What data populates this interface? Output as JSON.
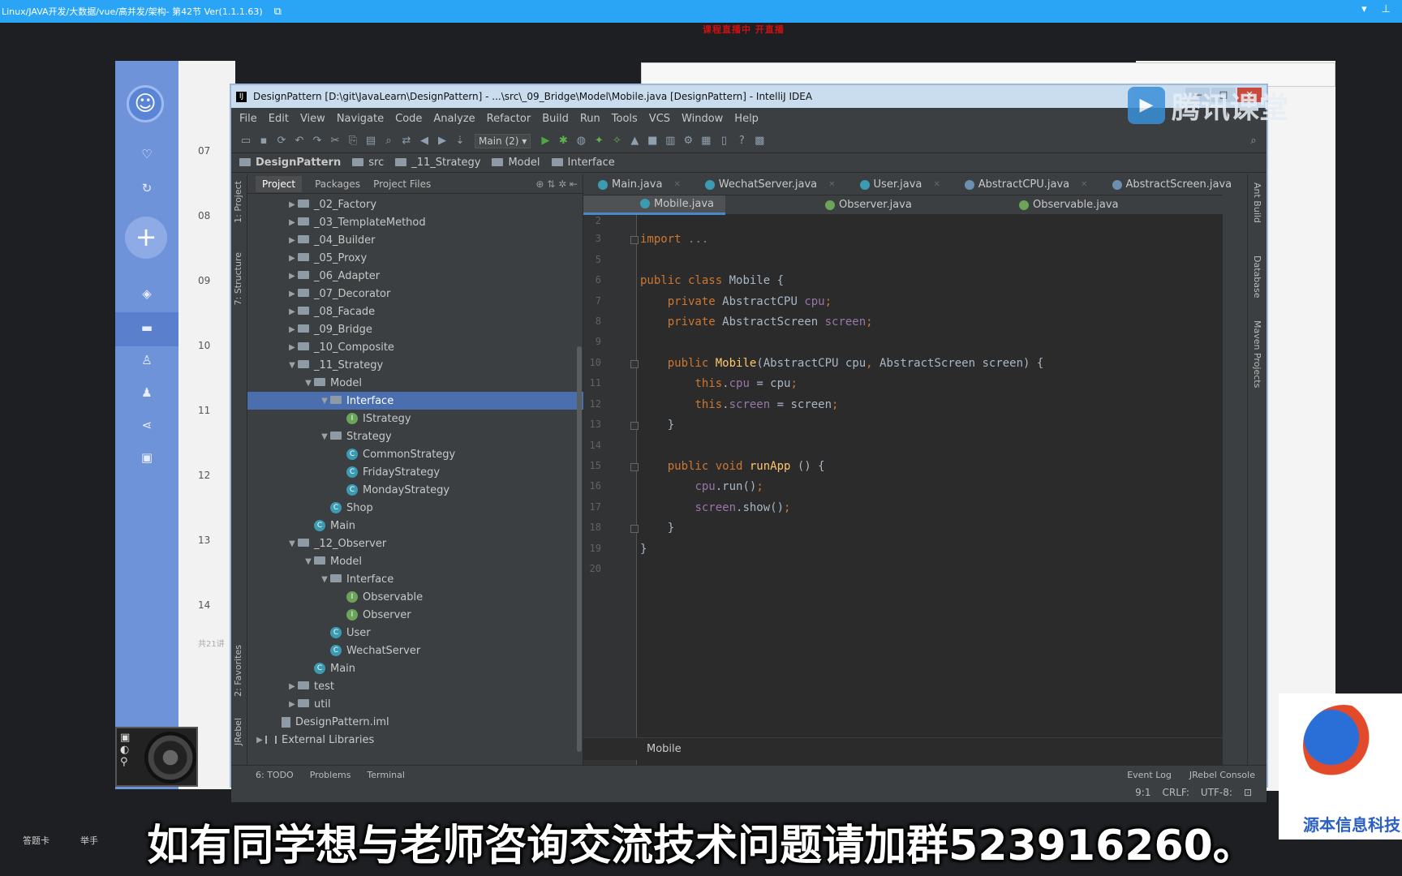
{
  "os": {
    "window_title": "Linux/JAVA开发/大数据/vue/高并发/架构- 第42节 Ver(1.1.1.63)",
    "red_notice": "课程直播中  开直播",
    "caption": "如有同学想与老师咨询交流技术问题请加群523916260。",
    "taskbar": [
      "答题卡",
      "举手"
    ]
  },
  "left_app": {
    "list_rows": [
      "07",
      "08",
      "09",
      "10",
      "11",
      "12",
      "13",
      "14"
    ],
    "footer": "共21讲"
  },
  "watermark": {
    "text": "腾讯课堂"
  },
  "brand": {
    "text": "源本信息科技"
  },
  "ide": {
    "title": "DesignPattern [D:\\git\\JavaLearn\\DesignPattern] - ...\\src\\_09_Bridge\\Model\\Mobile.java [DesignPattern] - IntelliJ IDEA",
    "menu": [
      "File",
      "Edit",
      "View",
      "Navigate",
      "Code",
      "Analyze",
      "Refactor",
      "Build",
      "Run",
      "Tools",
      "VCS",
      "Window",
      "Help"
    ],
    "run_config": "Main (2)",
    "breadcrumb": [
      "DesignPattern",
      "src",
      "_11_Strategy",
      "Model",
      "Interface"
    ],
    "project_tabs": [
      "Project",
      "Packages",
      "Project Files"
    ],
    "left_tools": [
      "1: Project",
      "7: Structure",
      "2: Favorites",
      "JRebel"
    ],
    "right_tools": [
      "Ant Build",
      "Database",
      "Maven Projects"
    ],
    "tree": [
      {
        "label": "_02_Factory",
        "indent": 2,
        "type": "folder",
        "arrow": "right"
      },
      {
        "label": "_03_TemplateMethod",
        "indent": 2,
        "type": "folder",
        "arrow": "right"
      },
      {
        "label": "_04_Builder",
        "indent": 2,
        "type": "folder",
        "arrow": "right"
      },
      {
        "label": "_05_Proxy",
        "indent": 2,
        "type": "folder",
        "arrow": "right"
      },
      {
        "label": "_06_Adapter",
        "indent": 2,
        "type": "folder",
        "arrow": "right"
      },
      {
        "label": "_07_Decorator",
        "indent": 2,
        "type": "folder",
        "arrow": "right"
      },
      {
        "label": "_08_Facade",
        "indent": 2,
        "type": "folder",
        "arrow": "right"
      },
      {
        "label": "_09_Bridge",
        "indent": 2,
        "type": "folder",
        "arrow": "right"
      },
      {
        "label": "_10_Composite",
        "indent": 2,
        "type": "folder",
        "arrow": "right"
      },
      {
        "label": "_11_Strategy",
        "indent": 2,
        "type": "folder",
        "arrow": "down"
      },
      {
        "label": "Model",
        "indent": 3,
        "type": "folder",
        "arrow": "down"
      },
      {
        "label": "Interface",
        "indent": 4,
        "type": "folder",
        "arrow": "down",
        "selected": true
      },
      {
        "label": "IStrategy",
        "indent": 5,
        "type": "interface",
        "arrow": ""
      },
      {
        "label": "Strategy",
        "indent": 4,
        "type": "folder",
        "arrow": "down"
      },
      {
        "label": "CommonStrategy",
        "indent": 5,
        "type": "class",
        "arrow": ""
      },
      {
        "label": "FridayStrategy",
        "indent": 5,
        "type": "class",
        "arrow": ""
      },
      {
        "label": "MondayStrategy",
        "indent": 5,
        "type": "class",
        "arrow": ""
      },
      {
        "label": "Shop",
        "indent": 4,
        "type": "class",
        "arrow": ""
      },
      {
        "label": "Main",
        "indent": 3,
        "type": "class",
        "arrow": ""
      },
      {
        "label": "_12_Observer",
        "indent": 2,
        "type": "folder",
        "arrow": "down"
      },
      {
        "label": "Model",
        "indent": 3,
        "type": "folder",
        "arrow": "down"
      },
      {
        "label": "Interface",
        "indent": 4,
        "type": "folder",
        "arrow": "down"
      },
      {
        "label": "Observable",
        "indent": 5,
        "type": "interface",
        "arrow": ""
      },
      {
        "label": "Observer",
        "indent": 5,
        "type": "interface",
        "arrow": ""
      },
      {
        "label": "User",
        "indent": 4,
        "type": "class",
        "arrow": ""
      },
      {
        "label": "WechatServer",
        "indent": 4,
        "type": "class",
        "arrow": ""
      },
      {
        "label": "Main",
        "indent": 3,
        "type": "class",
        "arrow": ""
      },
      {
        "label": "test",
        "indent": 2,
        "type": "folder",
        "arrow": "right"
      },
      {
        "label": "util",
        "indent": 2,
        "type": "folder",
        "arrow": "right"
      },
      {
        "label": "DesignPattern.iml",
        "indent": 1,
        "type": "iml",
        "arrow": ""
      },
      {
        "label": "External Libraries",
        "indent": 0,
        "type": "lib",
        "arrow": "right"
      }
    ],
    "tabs_row1": [
      "Main.java",
      "WechatServer.java",
      "User.java",
      "AbstractCPU.java",
      "AbstractScreen.java"
    ],
    "tabs_row2": [
      "Mobile.java",
      "Observer.java",
      "Observable.java"
    ],
    "line_numbers": [
      "2",
      "3",
      "5",
      "6",
      "7",
      "8",
      "9",
      "10",
      "11",
      "12",
      "13",
      "14",
      "15",
      "16",
      "17",
      "18",
      "19",
      "20"
    ],
    "code_breadcrumb": "Mobile",
    "bottom_tools": [
      "6: TODO",
      "Problems",
      "Terminal"
    ],
    "bottom_right": [
      "Event Log",
      "JRebel Console"
    ],
    "status": [
      "9:1",
      "CRLF:",
      "UTF-8:"
    ]
  }
}
